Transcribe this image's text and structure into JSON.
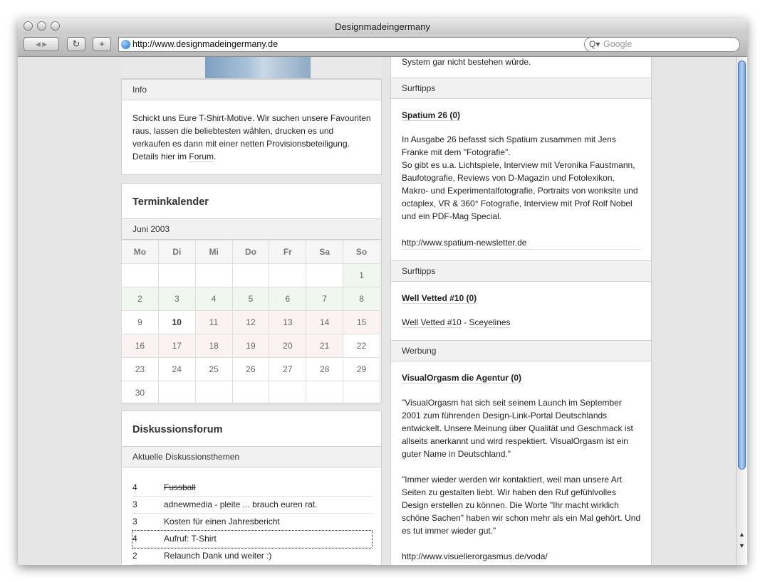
{
  "browser": {
    "window_title": "Designmadeingermany",
    "url": "http://www.designmadeingermany.de",
    "search_placeholder": "Google",
    "back_fwd": "◀ ▶",
    "reload": "↻",
    "add": "+"
  },
  "left": {
    "info": {
      "heading": "Info",
      "lines": [
        "Schickt uns Eure T-Shirt-Motive. Wir suchen unsere Favouriten",
        "raus, lassen die beliebtesten wählen, drucken es und",
        "verkaufen es dann mit einer netten Provisionsbeteiligung."
      ],
      "last_line_prefix": "Details hier im ",
      "last_line_link": "Forum",
      "last_line_suffix": "."
    },
    "calendar": {
      "heading": "Terminkalender",
      "month": "Juni 2003",
      "weekdays": [
        "Mo",
        "Di",
        "Mi",
        "Do",
        "Fr",
        "Sa",
        "So"
      ],
      "weeks": [
        [
          "",
          "",
          "",
          "",
          "",
          "",
          "1"
        ],
        [
          "2",
          "3",
          "4",
          "5",
          "6",
          "7",
          "8"
        ],
        [
          "9",
          "10",
          "11",
          "12",
          "13",
          "14",
          "15"
        ],
        [
          "16",
          "17",
          "18",
          "19",
          "20",
          "21",
          "22"
        ],
        [
          "23",
          "24",
          "25",
          "26",
          "27",
          "28",
          "29"
        ],
        [
          "30",
          "",
          "",
          "",
          "",
          "",
          ""
        ]
      ]
    },
    "forum": {
      "heading": "Diskussionsforum",
      "subheading": "Aktuelle Diskussionsthemen",
      "rows": [
        {
          "count": "4",
          "title": "Fussball"
        },
        {
          "count": "3",
          "title": "adnewmedia - pleite ... brauch euren rat."
        },
        {
          "count": "3",
          "title": "Kosten für einen Jahresbericht"
        },
        {
          "count": "4",
          "title": "Aufruf: T-Shirt"
        },
        {
          "count": "2",
          "title": "Relaunch Dank und weiter :)"
        }
      ]
    }
  },
  "right": {
    "top_line": "System gar nicht bestehen würde.",
    "surf1": {
      "heading": "Surftipps",
      "title": "Spatium 26 (0)",
      "lines": [
        "In Ausgabe 26 befasst sich Spatium zusammen mit Jens",
        "Franke mit dem \"Fotografie\".",
        "So gibt es u.a. Lichtspiele, Interview mit Veronika Faustmann,",
        "Baufotografie, Reviews von D-Magazin und Fotolexikon,",
        "Makro- und Experimentalfotografie, Portraits von wonksite und",
        "octaplex, VR & 360° Fotografie, Interview mit Prof Rolf Nobel",
        "und ein PDF-Mag Special."
      ],
      "link": "http://www.spatium-newsletter.de"
    },
    "surf2": {
      "heading": "Surftipps",
      "title": "Well Vetted #10 (0)",
      "link_a": "Well Vetted #10",
      "sep": " - ",
      "link_b": "Sceyelines"
    },
    "ad": {
      "heading": "Werbung",
      "title": "VisualOrgasm die Agentur (0)",
      "para1": [
        "\"VisualOrgasm hat sich seit seinem Launch im September",
        "2001 zum führenden Design-Link-Portal Deutschlands",
        "entwickelt. Unsere Meinung über Qualität und Geschmack ist",
        "allseits anerkannt und wird respektiert. VisualOrgasm ist ein",
        "guter Name in Deutschland.\""
      ],
      "para2": [
        "\"Immer wieder werden wir kontaktiert, weil man unsere Art",
        "Seiten zu gestalten liebt. Wir haben den Ruf gefühlvolles",
        "Design erstellen zu können. Die Worte \"Ihr macht wirklich",
        "schöne Sachen\" haben wir schon mehr als ein Mal gehört. Und",
        "es tut immer wieder gut.\""
      ],
      "link": "http://www.visuellerorgasmus.de/voda/"
    }
  }
}
